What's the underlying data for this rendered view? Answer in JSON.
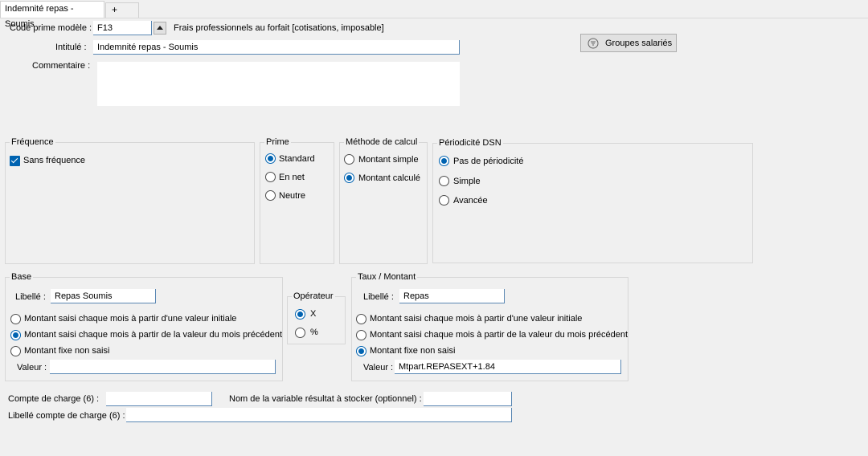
{
  "tabs": {
    "active": "Indemnité repas - Soumis",
    "add": "+"
  },
  "header": {
    "code_label": "Code prime modèle :",
    "code_value": "F13",
    "code_desc": "Frais professionnels au forfait [cotisations, imposable]",
    "intitule_label": "Intitulé :",
    "intitule_value": "Indemnité repas - Soumis",
    "commentaire_label": "Commentaire :",
    "commentaire_value": "",
    "groupes_button": "Groupes salariés"
  },
  "frequence": {
    "legend": "Fréquence",
    "sans": "Sans fréquence",
    "sans_checked": true
  },
  "prime": {
    "legend": "Prime",
    "options": [
      "Standard",
      "En net",
      "Neutre"
    ],
    "selected": "Standard"
  },
  "methode": {
    "legend": "Méthode de calcul",
    "options": [
      "Montant simple",
      "Montant calculé"
    ],
    "selected": "Montant calculé"
  },
  "periodicite": {
    "legend": "Périodicité DSN",
    "options": [
      "Pas de périodicité",
      "Simple",
      "Avancée"
    ],
    "selected": "Pas de périodicité"
  },
  "base": {
    "legend": "Base",
    "libelle_label": "Libellé :",
    "libelle_value": "Repas Soumis",
    "options": [
      "Montant saisi chaque mois à partir d'une valeur initiale",
      "Montant saisi chaque mois à partir de la valeur du mois précédent",
      "Montant fixe non saisi"
    ],
    "selected": "Montant saisi chaque mois à partir de la valeur du mois précédent",
    "valeur_label": "Valeur :",
    "valeur_value": ""
  },
  "operateur": {
    "legend": "Opérateur",
    "options": [
      "X",
      "%"
    ],
    "selected": "X"
  },
  "taux": {
    "legend": "Taux / Montant",
    "libelle_label": "Libellé :",
    "libelle_value": "Repas",
    "options": [
      "Montant saisi chaque mois à partir d'une valeur initiale",
      "Montant saisi chaque mois à partir de la valeur du mois précédent",
      "Montant fixe non saisi"
    ],
    "selected": "Montant fixe non saisi",
    "valeur_label": "Valeur :",
    "valeur_value": "Mtpart.REPASEXT+1.84"
  },
  "footer": {
    "compte_label": "Compte de charge (6) :",
    "compte_value": "",
    "variable_label": "Nom de la variable résultat à stocker (optionnel) :",
    "variable_value": "",
    "libelle_compte_label": "Libellé compte de charge (6) :",
    "libelle_compte_value": ""
  },
  "colors": {
    "accent": "#0063b1",
    "field_border": "#5a87b3",
    "background": "#f0f0f0"
  },
  "icons": {
    "groupes_button": "groups-filter-icon",
    "check": "check-icon"
  }
}
